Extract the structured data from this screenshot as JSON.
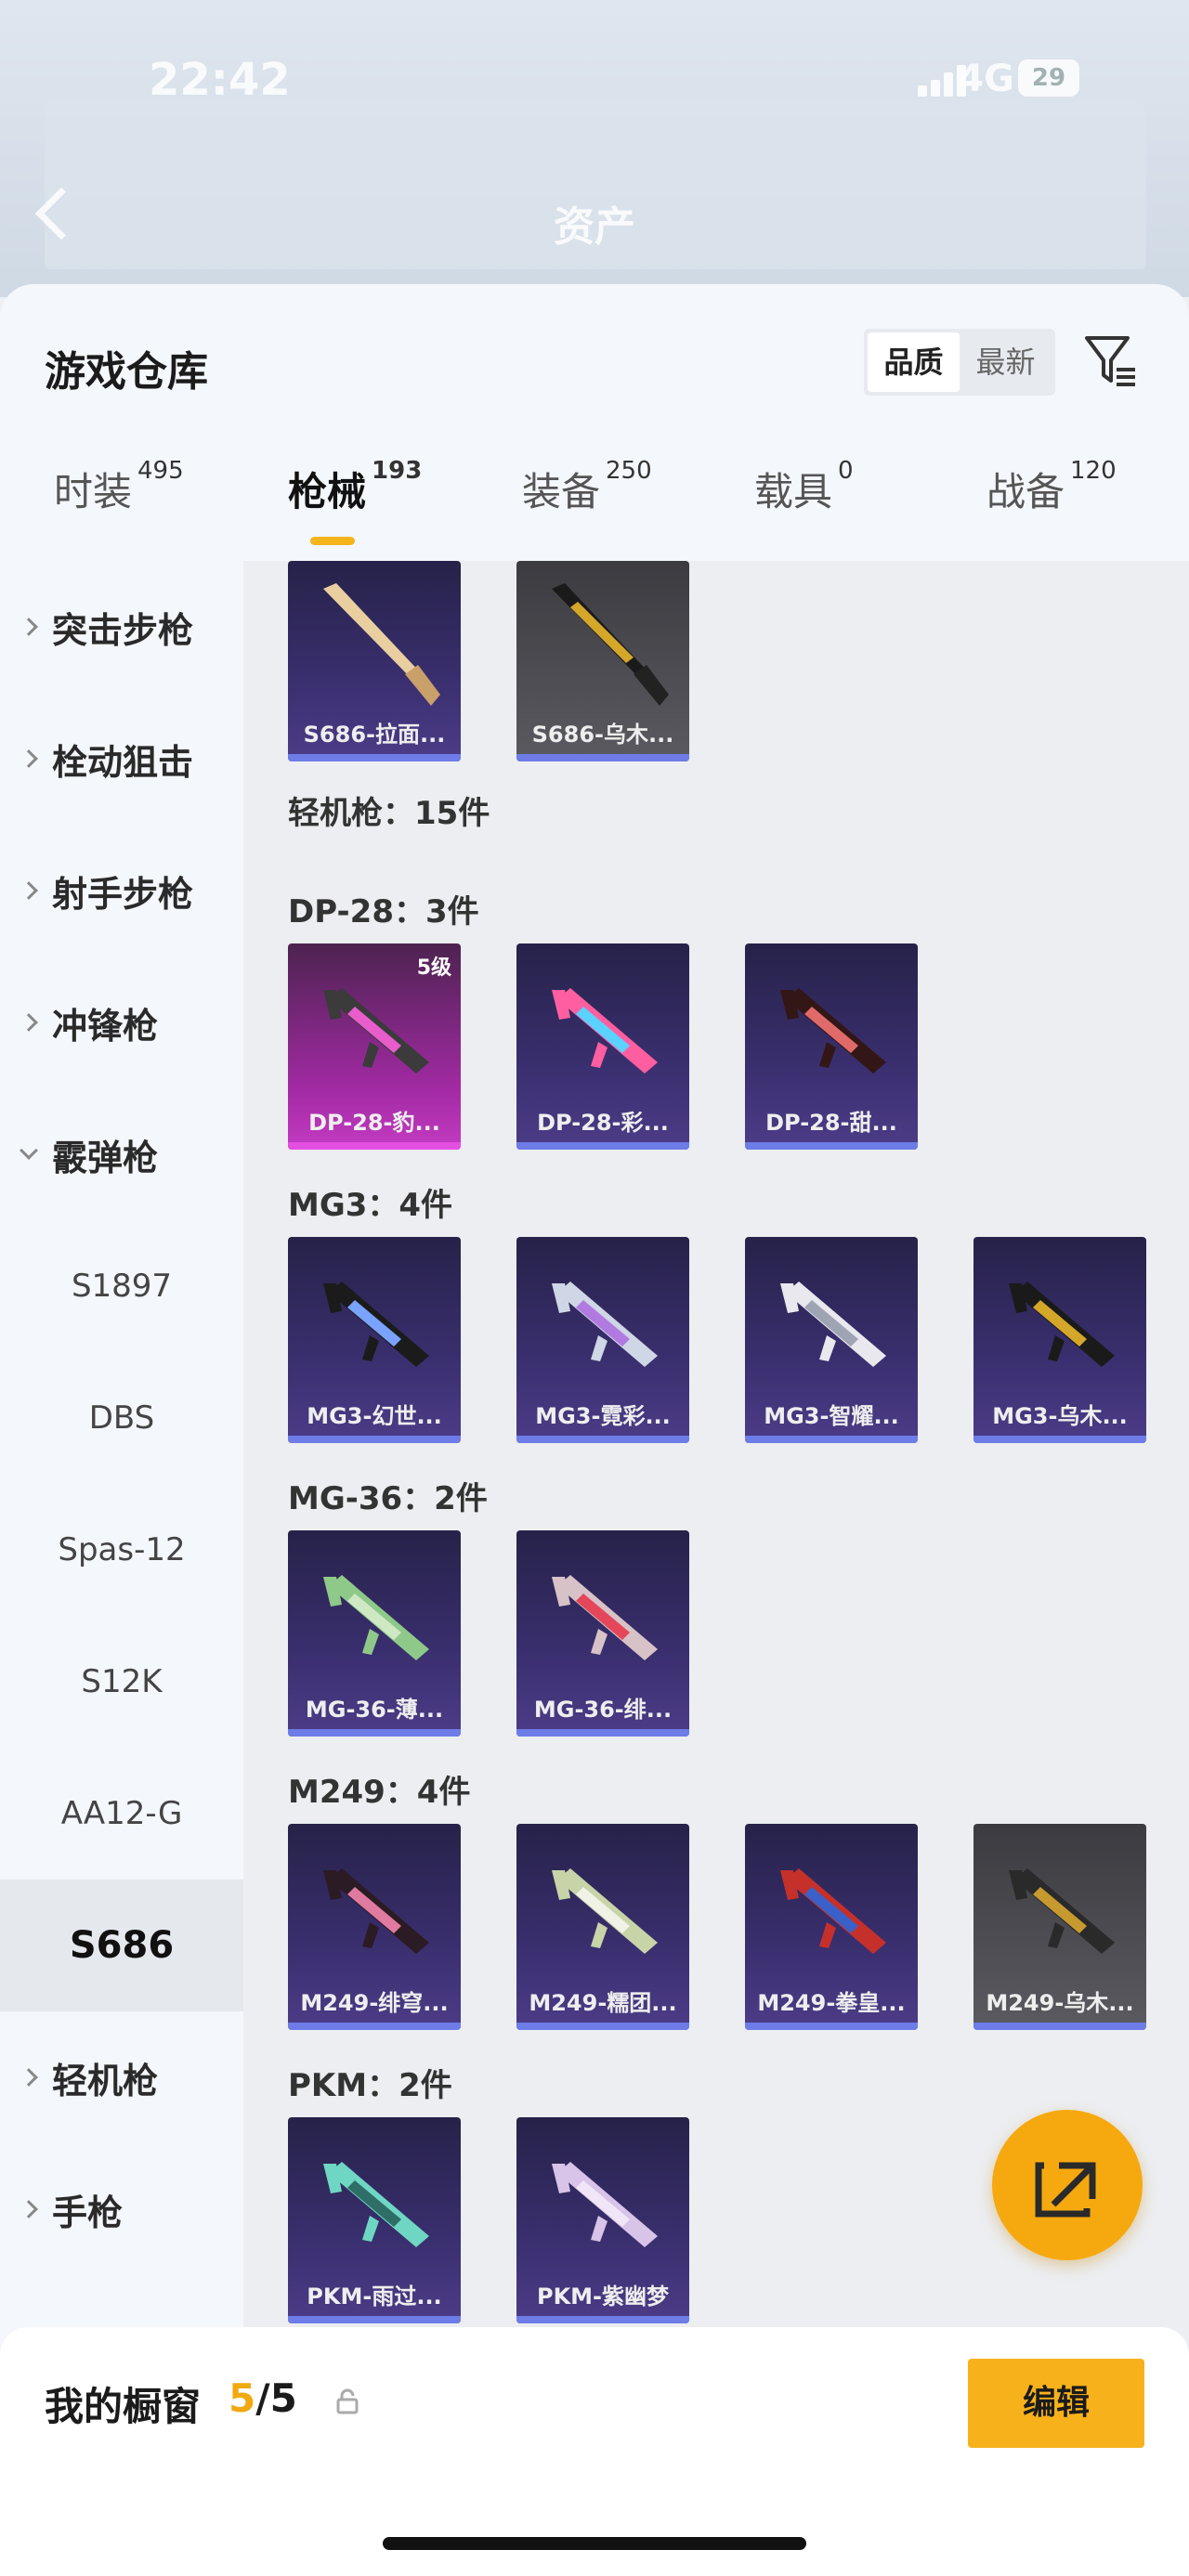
{
  "status_bar": {
    "time": "22:42",
    "network": "4G",
    "battery": "29"
  },
  "nav": {
    "title": "资产"
  },
  "sheet": {
    "title": "游戏仓库",
    "sort_options": [
      {
        "label": "品质",
        "active": true
      },
      {
        "label": "最新",
        "active": false
      }
    ],
    "filter_icon": "filter-icon"
  },
  "tabs": [
    {
      "label": "时装",
      "count": "495",
      "active": false
    },
    {
      "label": "枪械",
      "count": "193",
      "active": true
    },
    {
      "label": "装备",
      "count": "250",
      "active": false
    },
    {
      "label": "载具",
      "count": "0",
      "active": false
    },
    {
      "label": "战备",
      "count": "120",
      "active": false
    }
  ],
  "sidebar": {
    "categories": [
      {
        "label": "突击步枪",
        "expanded": false
      },
      {
        "label": "栓动狙击",
        "expanded": false
      },
      {
        "label": "射手步枪",
        "expanded": false
      },
      {
        "label": "冲锋枪",
        "expanded": false
      },
      {
        "label": "霰弹枪",
        "expanded": true
      }
    ],
    "subitems": [
      "S1897",
      "DBS",
      "Spas-12",
      "S12K",
      "AA12-G",
      "S686"
    ],
    "selected_subitem": "S686",
    "categories_after": [
      {
        "label": "轻机枪",
        "expanded": false
      },
      {
        "label": "手枪",
        "expanded": false
      }
    ]
  },
  "content": {
    "top_cards": [
      {
        "name": "S686-拉面...",
        "style": "purple"
      },
      {
        "name": "S686-乌木...",
        "style": "gray"
      }
    ],
    "section_title": "轻机枪：15件",
    "groups": [
      {
        "title": "DP-28：3件",
        "cards": [
          {
            "name": "DP-28-豹...",
            "style": "pink",
            "level": "5级"
          },
          {
            "name": "DP-28-彩...",
            "style": "purple"
          },
          {
            "name": "DP-28-甜...",
            "style": "purple"
          }
        ]
      },
      {
        "title": "MG3：4件",
        "cards": [
          {
            "name": "MG3-幻世...",
            "style": "purple"
          },
          {
            "name": "MG3-霓彩...",
            "style": "purple"
          },
          {
            "name": "MG3-智耀...",
            "style": "purple"
          },
          {
            "name": "MG3-乌木...",
            "style": "purple"
          }
        ]
      },
      {
        "title": "MG-36：2件",
        "cards": [
          {
            "name": "MG-36-薄...",
            "style": "purple"
          },
          {
            "name": "MG-36-绯...",
            "style": "purple"
          }
        ]
      },
      {
        "title": "M249：4件",
        "cards": [
          {
            "name": "M249-绯穹...",
            "style": "purple"
          },
          {
            "name": "M249-糯团...",
            "style": "purple"
          },
          {
            "name": "M249-拳皇...",
            "style": "purple"
          },
          {
            "name": "M249-乌木...",
            "style": "gray"
          }
        ]
      },
      {
        "title": "PKM：2件",
        "cards": [
          {
            "name": "PKM-雨过...",
            "style": "purple"
          },
          {
            "name": "PKM-紫幽梦",
            "style": "purple"
          }
        ]
      }
    ]
  },
  "fab": {
    "icon": "share-icon"
  },
  "showcase": {
    "title": "我的橱窗",
    "count_current": "5",
    "count_sep_total": "/5",
    "lock_icon": "lock-icon",
    "edit_label": "编辑"
  },
  "colors": {
    "accent": "#f6a90f",
    "card_purple": "#3a2f6f",
    "card_pink": "#c43bc2",
    "card_gray": "#5a5a60"
  }
}
